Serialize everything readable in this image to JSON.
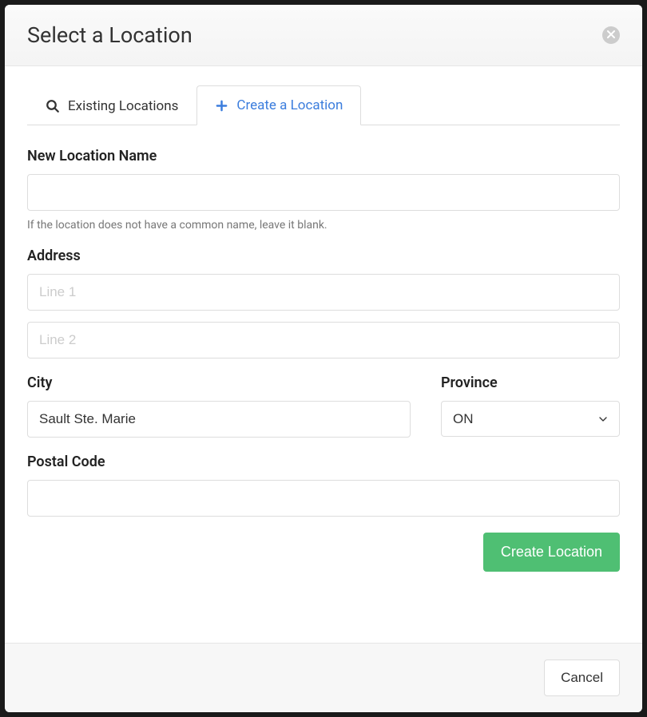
{
  "modal": {
    "title": "Select a Location"
  },
  "tabs": {
    "existing": "Existing Locations",
    "create": "Create a Location"
  },
  "form": {
    "location_name": {
      "label": "New Location Name",
      "value": "",
      "help": "If the location does not have a common name, leave it blank."
    },
    "address": {
      "label": "Address",
      "line1_placeholder": "Line 1",
      "line1_value": "",
      "line2_placeholder": "Line 2",
      "line2_value": ""
    },
    "city": {
      "label": "City",
      "value": "Sault Ste. Marie"
    },
    "province": {
      "label": "Province",
      "value": "ON"
    },
    "postal_code": {
      "label": "Postal Code",
      "value": ""
    }
  },
  "buttons": {
    "create": "Create Location",
    "cancel": "Cancel"
  }
}
